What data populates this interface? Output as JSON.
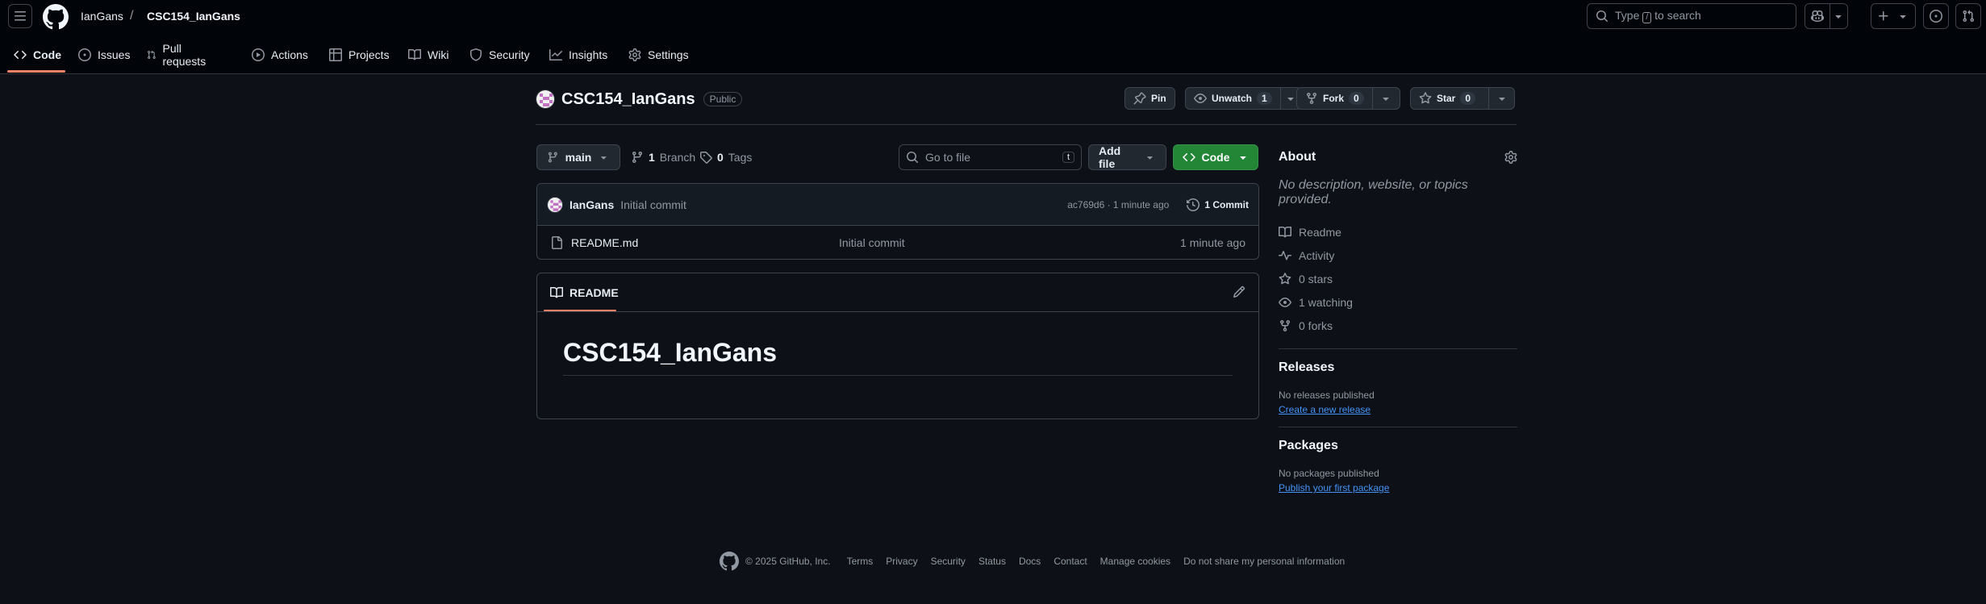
{
  "header": {
    "owner": "IanGans",
    "separator": "/",
    "repo": "CSC154_IanGans",
    "search_prefix": "Type",
    "search_key": "/",
    "search_suffix": "to search"
  },
  "nav": {
    "items": [
      "Code",
      "Issues",
      "Pull requests",
      "Actions",
      "Projects",
      "Wiki",
      "Security",
      "Insights",
      "Settings"
    ]
  },
  "repo": {
    "name": "CSC154_IanGans",
    "visibility": "Public",
    "pin_label": "Pin",
    "unwatch_label": "Unwatch",
    "watch_count": "1",
    "fork_label": "Fork",
    "fork_count": "0",
    "star_label": "Star",
    "star_count": "0"
  },
  "toolbar": {
    "branch": "main",
    "branch_count": "1",
    "branch_label": "Branch",
    "tag_count": "0",
    "tag_label": "Tags",
    "goto_placeholder": "Go to file",
    "goto_key": "t",
    "add_file_label": "Add file",
    "code_label": "Code"
  },
  "commit": {
    "author": "IanGans",
    "message": "Initial commit",
    "meta": "ac769d6 · 1 minute ago",
    "count_label": "1 Commit"
  },
  "files": [
    {
      "name": "README.md",
      "message": "Initial commit",
      "time": "1 minute ago"
    }
  ],
  "readme": {
    "tab_label": "README",
    "heading": "CSC154_IanGans"
  },
  "about": {
    "title": "About",
    "description": "No description, website, or topics provided.",
    "items": [
      "Readme",
      "Activity",
      "0 stars",
      "1 watching",
      "0 forks"
    ]
  },
  "releases": {
    "title": "Releases",
    "none_text": "No releases published",
    "link": "Create a new release"
  },
  "packages": {
    "title": "Packages",
    "none_text": "No packages published",
    "link": "Publish your first package"
  },
  "footer": {
    "copyright": "© 2025 GitHub, Inc.",
    "links": [
      "Terms",
      "Privacy",
      "Security",
      "Status",
      "Docs",
      "Contact",
      "Manage cookies",
      "Do not share my personal information"
    ]
  },
  "colors": {
    "background": "#0d1117",
    "header_bg": "#010409",
    "accent_underline": "#f78166",
    "code_button": "#238636",
    "link": "#4493f8"
  }
}
